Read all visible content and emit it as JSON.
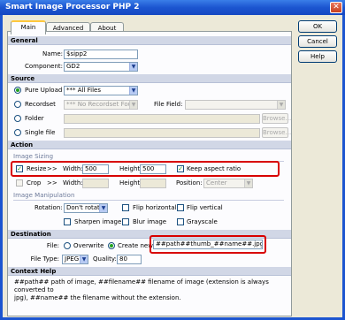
{
  "window": {
    "title": "Smart Image Processor PHP 2"
  },
  "tabs": [
    "Main",
    "Advanced",
    "About"
  ],
  "side_buttons": {
    "ok": "OK",
    "cancel": "Cancel",
    "help": "Help"
  },
  "general": {
    "header": "General",
    "name_label": "Name:",
    "name_value": "$sipp2",
    "component_label": "Component:",
    "component_value": "GD2"
  },
  "source": {
    "header": "Source",
    "pure_upload": "Pure Upload",
    "pure_upload_value": "*** All Files",
    "recordset": "Recordset",
    "recordset_value": "*** No Recordset Found",
    "file_field_label": "File Field:",
    "folder": "Folder",
    "single_file": "Single file",
    "browse": "Browse..."
  },
  "action": {
    "header": "Action",
    "image_sizing": "Image Sizing",
    "resize_label": "Resize",
    "arrows": ">>",
    "width_label": "Width:",
    "width_value": "500",
    "height_label": "Height:",
    "height_value": "500",
    "keep_aspect": "Keep aspect ratio",
    "crop_label": "Crop",
    "position_label": "Position:",
    "position_value": "Center",
    "image_manipulation": "Image Manipulation",
    "rotation_label": "Rotation:",
    "rotation_value": "Don't rotate",
    "flip_horizontal": "Flip horizontal",
    "flip_vertical": "Flip vertical",
    "sharpen": "Sharpen image",
    "blur": "Blur image",
    "grayscale": "Grayscale"
  },
  "destination": {
    "header": "Destination",
    "file_label": "File:",
    "overwrite": "Overwrite",
    "create_new": "Create new:",
    "create_new_value": "##path##thumb_##name##.jpg",
    "file_type_label": "File Type:",
    "file_type_value": "JPEG",
    "quality_label": "Quality:",
    "quality_value": "80"
  },
  "context_help": {
    "header": "Context Help",
    "line1": "##path## path of image, ##filename## filename of image (extension is always converted to",
    "line2": "jpg), ##name## the filename without the extension."
  },
  "colors": {
    "titlebar": "#1c55d0",
    "section_header": "#d1d7e6",
    "highlight": "#d80000",
    "checkmark": "#21a121"
  }
}
